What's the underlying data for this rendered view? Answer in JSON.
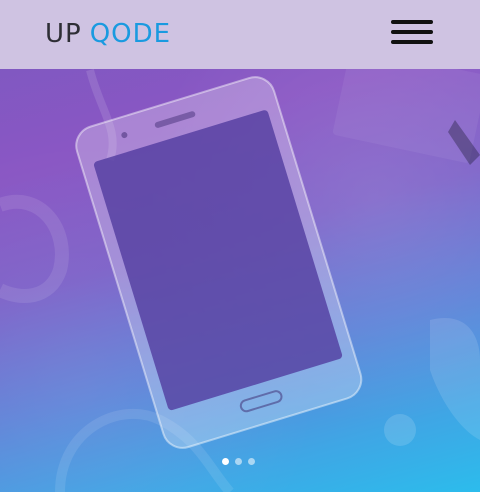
{
  "header": {
    "logo": {
      "first": "UP",
      "second": "QODE"
    },
    "menu_icon": "hamburger-icon"
  },
  "hero": {
    "image": "smartphone-on-desk",
    "slider": {
      "total_slides": 3,
      "active_slide": 1
    }
  },
  "colors": {
    "header_bg": "#cfc3e2",
    "logo_dark": "#2e2e35",
    "logo_accent": "#1a9ae0",
    "gradient_top": "#8a57c4",
    "gradient_bottom": "#2cbcec"
  }
}
